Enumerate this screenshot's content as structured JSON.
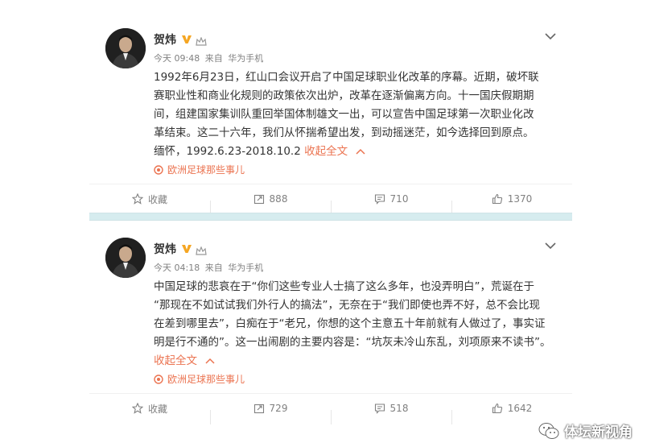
{
  "posts": [
    {
      "author": "贺炜",
      "time": "今天 09:48",
      "source_prefix": "来自",
      "source": "华为手机",
      "lines": [
        "1992年6月23日，红山口会议开启了中国足球职业化改革的序幕。近期，破坏联",
        "赛职业性和商业化规则的政策依次出炉，改革在逐渐偏离方向。十一国庆假期期",
        "间，组建国家集训队重回举国体制雄文一出，可以宣告中国足球第一次职业化改",
        "革结束。这二十六年，我们从怀揣希望出发，到动摇迷茫，如今选择回到原点。",
        "缅怀，1992.6.23-2018.10.2 "
      ],
      "toggle": "收起全文",
      "topic": "欧洲足球那些事儿",
      "actions": {
        "favorite": "收藏",
        "repost": "888",
        "comment": "710",
        "like": "1370"
      }
    },
    {
      "author": "贺炜",
      "time": "今天 04:18",
      "source_prefix": "来自",
      "source": "华为手机",
      "lines": [
        "中国足球的悲哀在于“你们这些专业人士搞了这么多年，也没弄明白”，荒诞在于",
        "“那现在不如试试我们外行人的搞法”，无奈在于“我们即使也弄不好，总不会比现",
        "在差到哪里去”，白痴在于“老兄，你想的这个主意五十年前就有人做过了，事实证",
        "明是行不通的”。这一出闹剧的主要内容是：“坑灰未冷山东乱，刘项原来不读书”。"
      ],
      "toggle": "收起全文",
      "topic": "欧洲足球那些事儿",
      "actions": {
        "favorite": "收藏",
        "repost": "729",
        "comment": "518",
        "like": "1642"
      }
    }
  ],
  "watermark": "体坛新视角",
  "colors": {
    "accent": "#eb7350",
    "meta": "#808080",
    "separator": "#d6ecef",
    "verified": "#f5a623"
  },
  "icons": {
    "verified": "v-badge-icon",
    "member": "crown-icon",
    "expand": "chevron-down-icon",
    "topic": "weibo-topic-icon",
    "favorite": "star-icon",
    "repost": "repost-icon",
    "comment": "comment-icon",
    "like": "thumbs-up-icon"
  }
}
